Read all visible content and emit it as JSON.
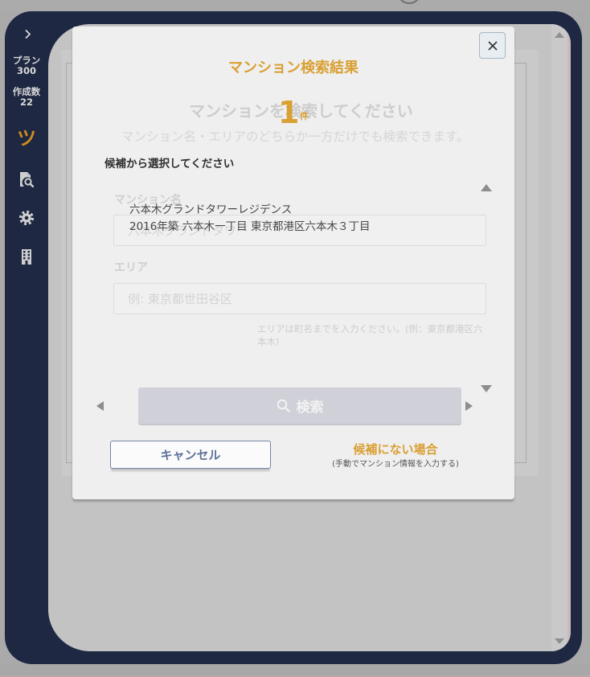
{
  "colors": {
    "accent_orange": "#d9a033",
    "logo_orange": "#cf8b1e",
    "frame_navy": "#1e2842",
    "backdrop_gray": "#c3c3c3",
    "modal_background": "#efefef",
    "cancel_blue": "#5f7298",
    "faded_text": "#cfcfcf"
  },
  "top_bar": {
    "icon": "circle-icon"
  },
  "sidebar": {
    "toggle_icon": "chevron-right-icon",
    "plan": {
      "label": "プラン",
      "value": "300"
    },
    "created_count": {
      "label": "作成数",
      "value": "22"
    },
    "nav": [
      {
        "icon": "tsu-logo-icon",
        "glyph": "ツ"
      },
      {
        "icon": "search-document-icon"
      },
      {
        "icon": "gear-icon"
      },
      {
        "icon": "building-icon"
      }
    ]
  },
  "main": {
    "scrollbar": {
      "up_icon": "scroll-up-arrow-icon",
      "down_icon": "scroll-down-arrow-icon"
    }
  },
  "search_form": {
    "heading": "マンションを検索してください",
    "subheading": "マンション名・エリアのどちらか一方だけでも検索できます。",
    "name_label": "マンション名",
    "name_placeholder": "六本木グランドタワー",
    "area_label": "エリア",
    "area_placeholder": "例: 東京都世田谷区",
    "area_help": "エリアは町名までを入力ください。(例：東京都港区六本木)",
    "search_button": "検索",
    "search_icon": "search-icon"
  },
  "results_modal": {
    "title": "マンション検索結果",
    "count": "1",
    "count_unit": "件",
    "instruction": "候補から選択してください",
    "candidates": [
      {
        "name": "六本木グランドタワーレジデンス",
        "detail": "2016年築 六本木一丁目 東京都港区六本木３丁目"
      }
    ],
    "close_icon": "close-icon",
    "cancel_button": "キャンセル",
    "not_found_label": "候補にない場合",
    "not_found_note": "(手動でマンション情報を入力する)"
  }
}
